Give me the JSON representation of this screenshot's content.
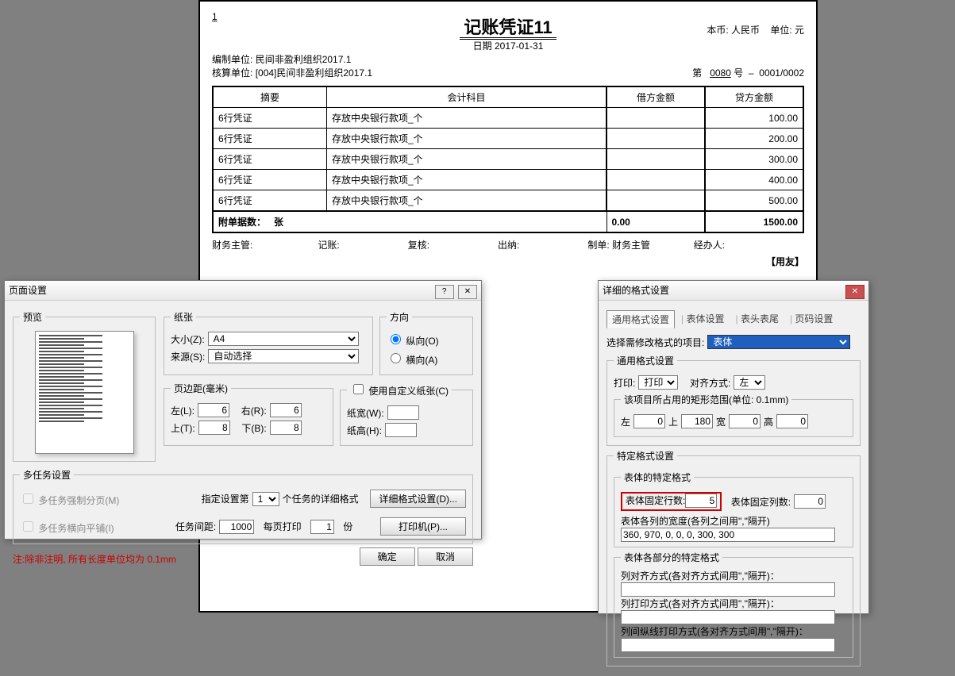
{
  "voucher": {
    "page_no": "1",
    "title": "记账凭证11",
    "currency_label": "本币: 人民币",
    "unit_label": "单位: 元",
    "org_label": "编制单位:",
    "org": "民间非盈利组织2017.1",
    "acct_org_label": "核算单位:",
    "acct_org": "[004]民间非盈利组织2017.1",
    "date_label": "日期",
    "date": "2017-01-31",
    "seq_label": "第",
    "seq_no": "0080",
    "seq_suffix": "号",
    "page_idx": "0001/0002",
    "cols": [
      "摘要",
      "会计科目",
      "借方金额",
      "贷方金额"
    ],
    "rows": [
      {
        "a": "6行凭证",
        "b": "存放中央银行款项_个",
        "c": "",
        "d": "100.00"
      },
      {
        "a": "6行凭证",
        "b": "存放中央银行款项_个",
        "c": "",
        "d": "200.00"
      },
      {
        "a": "6行凭证",
        "b": "存放中央银行款项_个",
        "c": "",
        "d": "300.00"
      },
      {
        "a": "6行凭证",
        "b": "存放中央银行款项_个",
        "c": "",
        "d": "400.00"
      },
      {
        "a": "6行凭证",
        "b": "存放中央银行款项_个",
        "c": "",
        "d": "500.00"
      }
    ],
    "sum_label": "附单据数：",
    "sum_unit": "张",
    "debit_sum": "0.00",
    "credit_sum": "1500.00",
    "footer": {
      "f1": "财务主管:",
      "f2": "记账:",
      "f3": "复核:",
      "f4": "出纳:",
      "f5": "制单: 财务主管",
      "f6": "经办人:"
    },
    "brand": "【用友】"
  },
  "dlg1": {
    "title": "页面设置",
    "preview": "预览",
    "paper": "纸张",
    "size_l": "大小(Z):",
    "size_v": "A4",
    "source_l": "来源(S):",
    "source_v": "自动选择",
    "orient": "方向",
    "portrait": "纵向(O)",
    "landscape": "横向(A)",
    "margin": "页边距(毫米)",
    "ml": "左(L):",
    "mr": "右(R):",
    "mt": "上(T):",
    "mb": "下(B):",
    "mlv": "6",
    "mrv": "6",
    "mtv": "8",
    "mbv": "8",
    "custom": "使用自定义纸张(C)",
    "pw": "纸宽(W):",
    "ph": "纸高(H):",
    "multi": "多任务设置",
    "force": "多任务强制分页(M)",
    "tile": "多任务横向平铺(I)",
    "spec1": "指定设置第",
    "spec1v": "1",
    "spec2": "个任务的详细格式",
    "detail_btn": "详细格式设置(D)...",
    "gap": "任务间距:",
    "gapv": "1000",
    "perpage": "每页打印",
    "perpagev": "1",
    "perpage2": "份",
    "printer": "打印机(P)...",
    "note": "注:除非注明, 所有长度单位均为 0.1mm",
    "ok": "确定",
    "cancel": "取消"
  },
  "dlg2": {
    "title": "详细的格式设置",
    "tabs": [
      "通用格式设置",
      "表体设置",
      "表头表尾",
      "页码设置"
    ],
    "sel_l": "选择需修改格式的项目:",
    "sel_v": "表体",
    "gen": "通用格式设置",
    "print_l": "打印:",
    "print_v": "打印",
    "align_l": "对齐方式:",
    "align_v": "左",
    "rect": "该项目所占用的矩形范围(单位: 0.1mm)",
    "rl": "左",
    "rt": "上",
    "rw": "宽",
    "rh": "高",
    "rlv": "0",
    "rtv": "180",
    "rwv": "0",
    "rhv": "0",
    "spec": "特定格式设置",
    "sub1": "表体的特定格式",
    "fixrow_l": "表体固定行数:",
    "fixrow_v": "5",
    "fixcol_l": "表体固定列数:",
    "fixcol_v": "0",
    "colw_l": "表体各列的宽度(各列之间用\",\"隔开)",
    "colw_v": "360, 970, 0, 0, 0, 300, 300",
    "sub2": "表体各部分的特定格式",
    "r1": "列对齐方式(各对齐方式间用\",\"隔开)：",
    "r2": "列打印方式(各对齐方式间用\",\"隔开)：",
    "r3": "列间纵线打印方式(各对齐方式间用\",\"隔开)："
  }
}
